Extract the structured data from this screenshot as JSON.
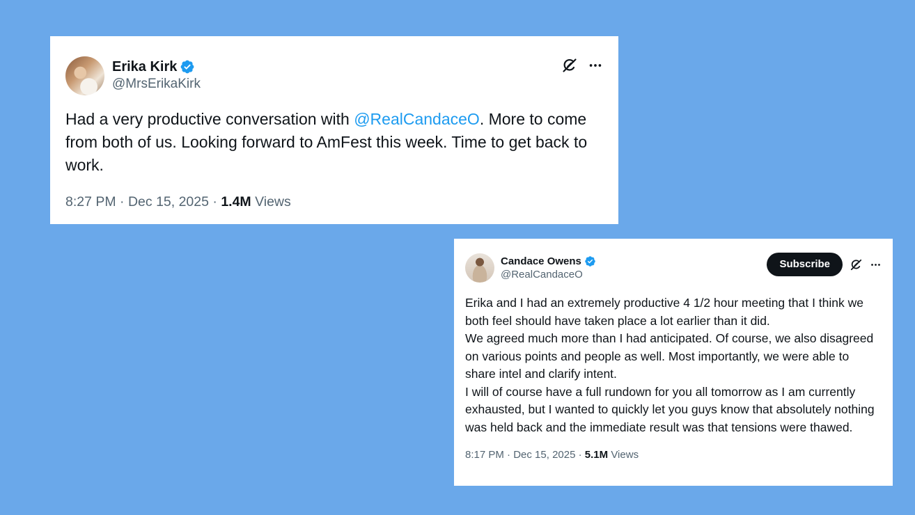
{
  "colors": {
    "background": "#6aa8ea",
    "card": "#ffffff",
    "text": "#0f1419",
    "secondary_text": "#536471",
    "mention": "#1d9bf0",
    "verified": "#1d9bf0",
    "subscribe_bg": "#0f1419"
  },
  "tweets": [
    {
      "display_name": "Erika Kirk",
      "handle": "@MrsErikaKirk",
      "verified_icon": "verified-badge-icon",
      "text_before_mention": "Had a very productive conversation with ",
      "mention": "@RealCandaceO",
      "text_after_mention": ". More to come from both of us. Looking forward to AmFest this week. Time to get back to work.",
      "time": "8:27 PM",
      "separator": " · ",
      "date": "Dec 15, 2025",
      "views_count": "1.4M",
      "views_label": " Views"
    },
    {
      "display_name": "Candace Owens",
      "handle": "@RealCandaceO",
      "verified_icon": "verified-badge-icon",
      "subscribe_label": "Subscribe",
      "paragraphs": [
        "Erika and I had an extremely productive 4 1/2 hour meeting that I think we both feel should have taken place a lot earlier than it did.",
        "We agreed much more than I had anticipated. Of course, we also disagreed on various points and people as well. Most importantly, we were able to share intel and clarify intent.",
        "I will of course have a full rundown for you all tomorrow as I am currently exhausted, but I wanted to quickly let you guys know that absolutely nothing was held back and the immediate result was that tensions were thawed."
      ],
      "time": "8:17 PM",
      "separator": " · ",
      "date": "Dec 15, 2025",
      "views_count": "5.1M",
      "views_label": " Views"
    }
  ]
}
